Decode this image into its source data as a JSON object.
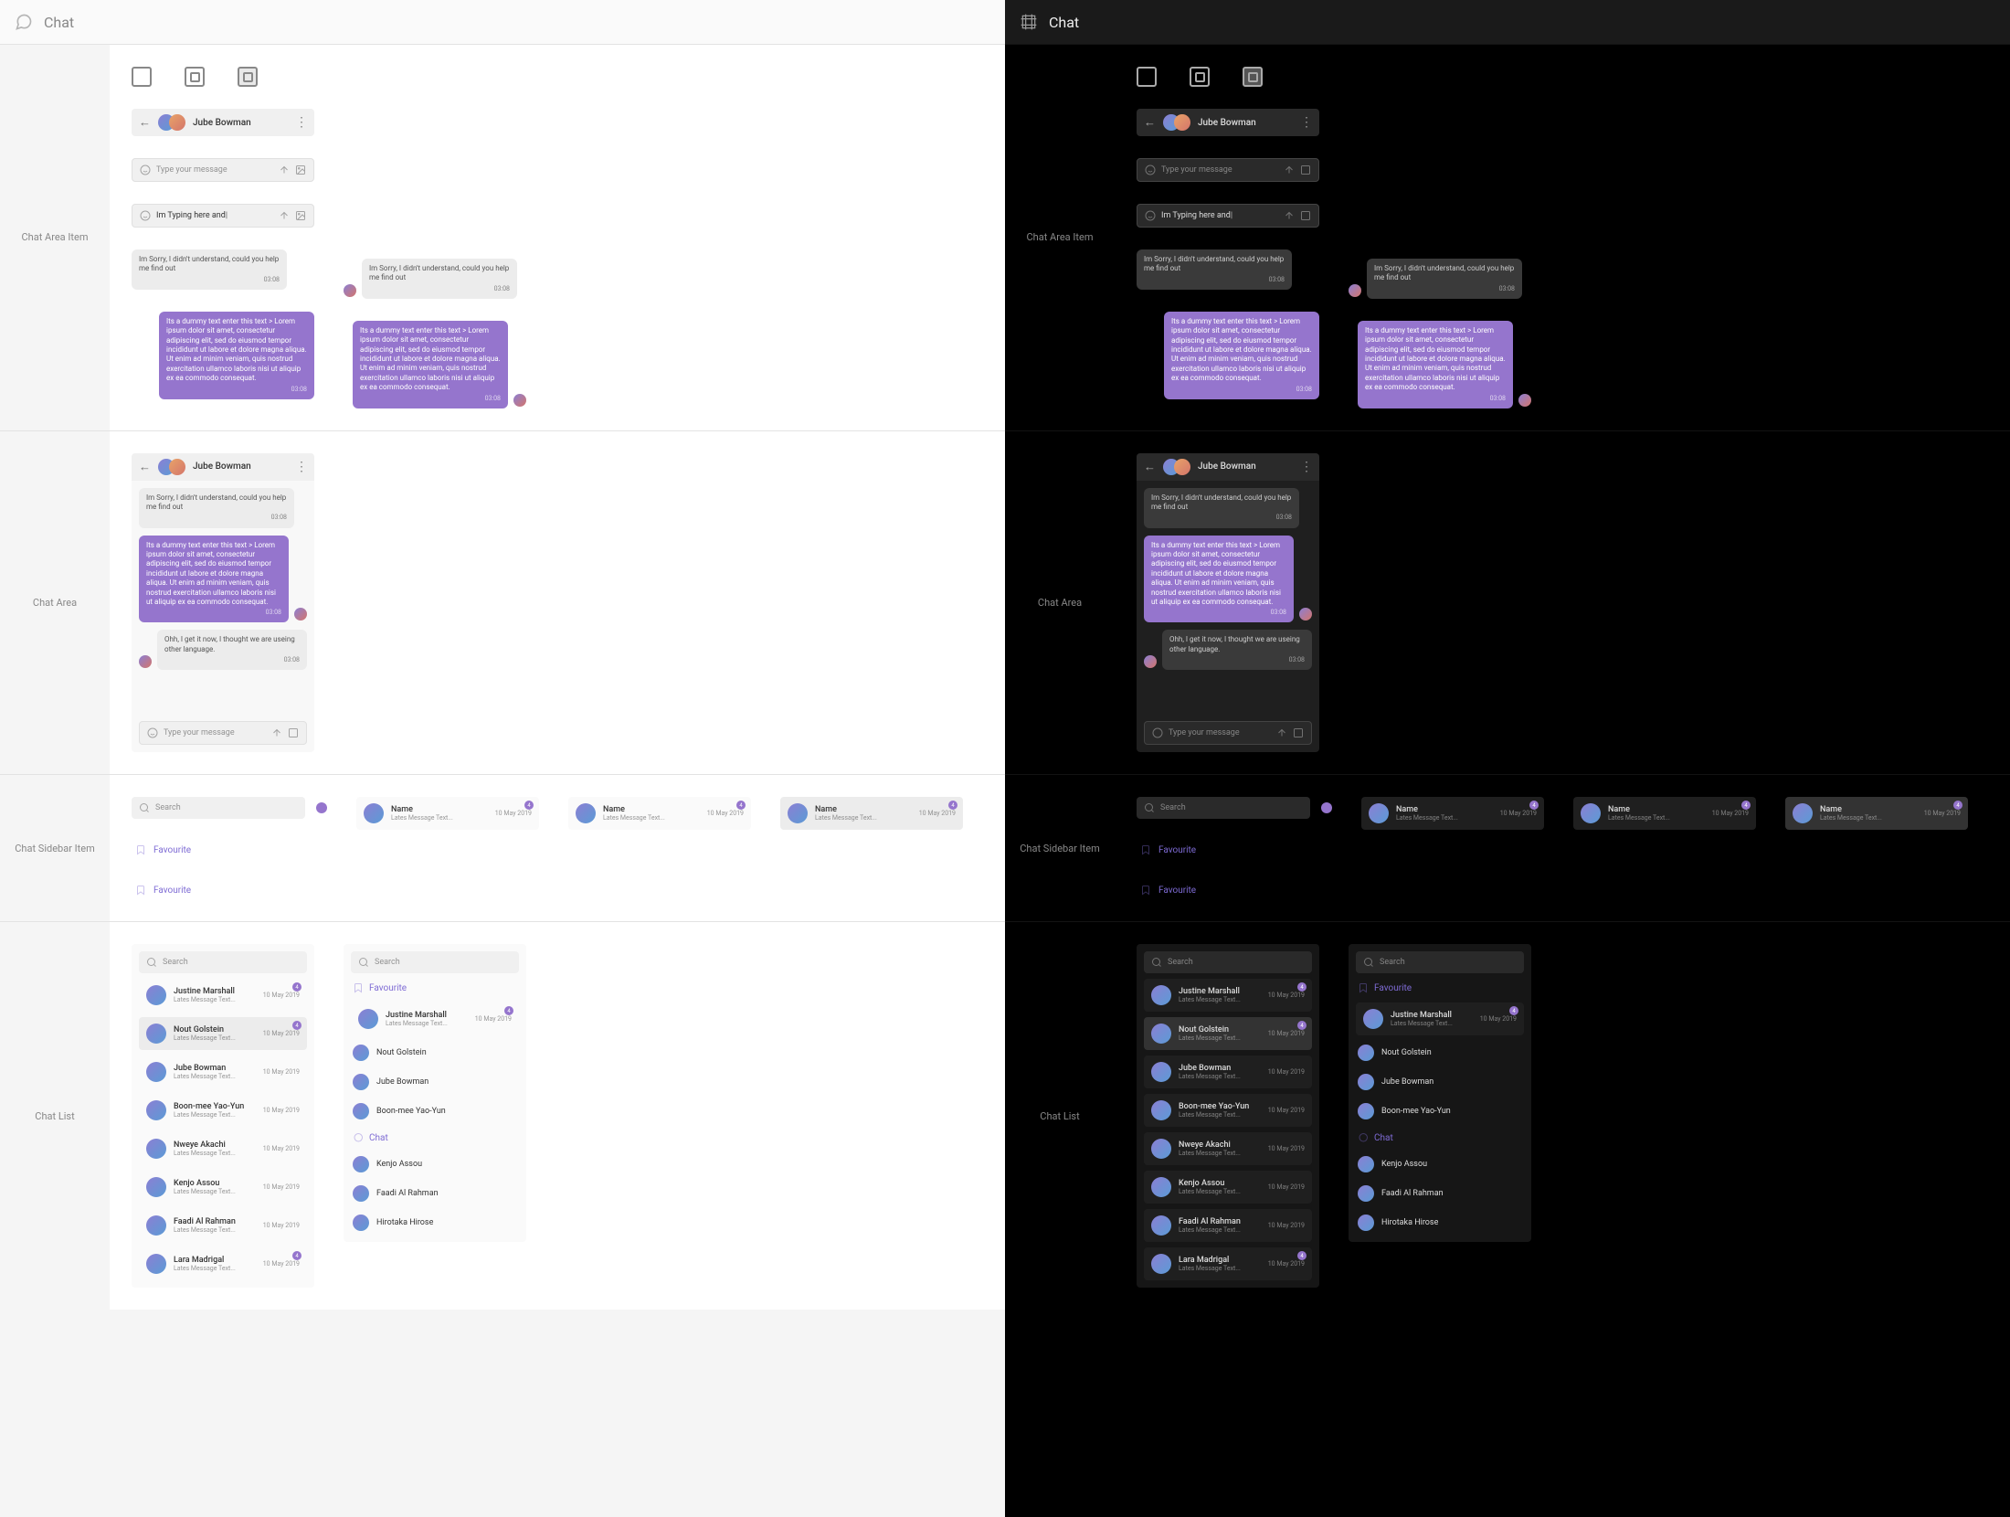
{
  "title": "Chat",
  "sections": {
    "chatAreaItem": "Chat Area Item",
    "chatArea": "Chat Area",
    "chatSidebarItem": "Chat Sidebar Item",
    "chatList": "Chat List"
  },
  "header": {
    "name": "Jube Bowman"
  },
  "input": {
    "placeholder": "Type your message",
    "typing": "Im Typing here and"
  },
  "messages": {
    "in": "Im Sorry, I didn't understand, could you help me find out",
    "out": "Its a dummy text enter this text > Lorem ipsum dolor sit amet, consectetur adipiscing elit, sed do eiusmod tempor incididunt ut labore et dolore magna aliqua. Ut enim ad minim veniam, quis nostrud exercitation ullamco laboris nisi ut aliquip ex ea commodo consequat.",
    "in2": "Ohh, I get it now, I thought we are useing other language.",
    "time": "03:08"
  },
  "search": {
    "placeholder": "Search"
  },
  "favourite": "Favourite",
  "chatLabel": "Chat",
  "genericContact": {
    "name": "Name",
    "sub": "Lates Message Text...",
    "date": "10 May 2019",
    "badge": "4"
  },
  "contacts": [
    {
      "name": "Justine Marshall",
      "sub": "Lates Message Text...",
      "date": "10 May 2019",
      "badge": "4"
    },
    {
      "name": "Nout Golstein",
      "sub": "Lates Message Text...",
      "date": "10 May 2019",
      "badge": "4",
      "selected": true
    },
    {
      "name": "Jube Bowman",
      "sub": "Lates Message Text...",
      "date": "10 May 2019"
    },
    {
      "name": "Boon-mee Yao-Yun",
      "sub": "Lates Message Text...",
      "date": "10 May 2019"
    },
    {
      "name": "Nweye Akachi",
      "sub": "Lates Message Text...",
      "date": "10 May 2019"
    },
    {
      "name": "Kenjo Assou",
      "sub": "Lates Message Text...",
      "date": "10 May 2019"
    },
    {
      "name": "Faadi Al Rahman",
      "sub": "Lates Message Text...",
      "date": "10 May 2019"
    },
    {
      "name": "Lara Madrigal",
      "sub": "Lates Message Text...",
      "date": "10 May 2019",
      "badge": "4"
    }
  ],
  "favList": [
    {
      "name": "Justine Marshall",
      "sub": "Lates Message Text...",
      "date": "10 May 2019",
      "badge": "4"
    },
    {
      "name": "Nout Golstein",
      "sub": "Lates Message Text...",
      "date": "10 May 2019",
      "badge": "4",
      "selected": true
    },
    {
      "name": "Jube Bowman",
      "sub": "Lates Message Text...",
      "date": "10 May 2019"
    },
    {
      "name": "Boon-mee Yao-Yun",
      "sub": "Lates Message Text...",
      "date": "10 May 2019"
    }
  ],
  "simpleList": [
    "Nout Golstein",
    "Jube Bowman",
    "Boon-mee Yao-Yun"
  ],
  "chatSimpleList": [
    "Kenjo Assou",
    "Faadi Al Rahman",
    "Hirotaka Hirose"
  ]
}
